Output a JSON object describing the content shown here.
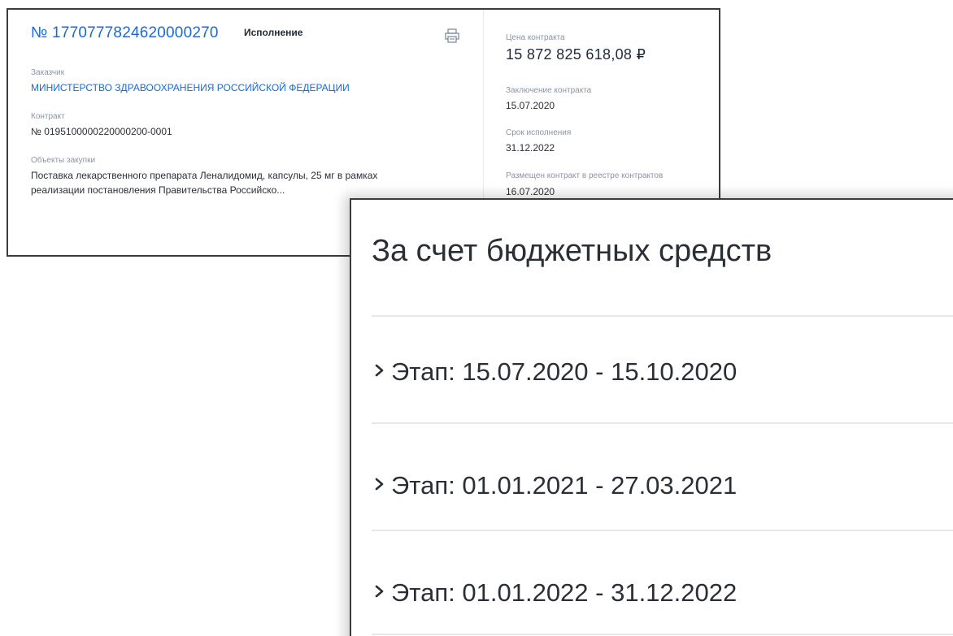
{
  "contract_card": {
    "number": "№ 1770777824620000270",
    "status": "Исполнение",
    "print_icon": "printer-icon",
    "customer_label": "Заказчик",
    "customer_value": "МИНИСТЕРСТВО ЗДРАВООХРАНЕНИЯ РОССИЙСКОЙ ФЕДЕРАЦИИ",
    "contract_label": "Контракт",
    "contract_value": "№ 0195100000220000200-0001",
    "objects_label": "Объекты закупки",
    "objects_line1": "Поставка лекарственного препарата Леналидомид, капсулы, 25 мг в рамках",
    "objects_line2": "реализации постановления Правительства Российско...",
    "price_label": "Цена контракта",
    "price_value": "15 872 825 618,08 ₽",
    "conclusion_label": "Заключение контракта",
    "conclusion_value": "15.07.2020",
    "deadline_label": "Срок исполнения",
    "deadline_value": "31.12.2022",
    "registry_label": "Размещен контракт в реестре контрактов",
    "registry_value": "16.07.2020"
  },
  "finance_panel": {
    "title": "За счет бюджетных средств",
    "stages": [
      {
        "label": "Этап: 15.07.2020 - 15.10.2020",
        "icon": "chevron-right-icon"
      },
      {
        "label": "Этап: 01.01.2021 - 27.03.2021",
        "icon": "chevron-right-icon"
      },
      {
        "label": "Этап: 01.01.2022 - 31.12.2022",
        "icon": "chevron-right-icon"
      }
    ]
  },
  "colors": {
    "link": "#1a6ad1",
    "text": "#2a2f36",
    "muted": "#8a94a6",
    "divider": "#e4e7eb"
  }
}
